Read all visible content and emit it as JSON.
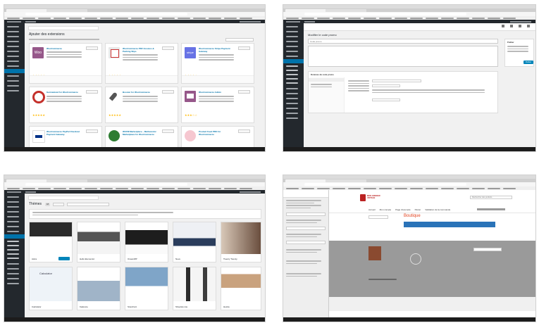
{
  "colors": {
    "wp_admin_dark": "#23282d",
    "wp_admin_blue": "#0073aa",
    "woo_purple": "#96588a",
    "stripe_purple": "#6772e5",
    "elementor_grey": "#7a7a7a",
    "star_gold": "#ffb900",
    "boutique_red": "#e2401c"
  },
  "shot1": {
    "page_title": "Ajouter des extensions",
    "plugins": [
      {
        "name": "WooCommerce",
        "icon": "woo-icon"
      },
      {
        "name": "WooCommerce PDF Invoices & Packing Slips",
        "icon": "invoice-icon"
      },
      {
        "name": "WooCommerce Stripe Payment Gateway",
        "icon": "stripe-icon"
      },
      {
        "name": "Germanized for WooCommerce",
        "icon": "germanized-icon"
      },
      {
        "name": "Booster for WooCommerce",
        "icon": "rocket-icon"
      },
      {
        "name": "WooCommerce Admin",
        "icon": "admin-icon"
      },
      {
        "name": "WooCommerce PayPal Checkout Payment Gateway",
        "icon": "paypal-icon"
      },
      {
        "name": "WCFM Marketplace – Multivendor Marketplace for WooCommerce",
        "icon": "wcfm-icon"
      },
      {
        "name": "Product Feed PRO for WooCommerce",
        "icon": "pig-icon"
      }
    ],
    "woo_logo_text": "Woo",
    "stripe_logo_text": "stripe"
  },
  "shot2": {
    "page_title": "Modifier le code promo",
    "code_field_value": "Code promo",
    "publish_heading": "Publier",
    "publish_button": "Publier",
    "coupon_data_heading": "Données du code promo"
  },
  "shot3": {
    "page_title": "Thèmes",
    "theme_count": "18",
    "themes": [
      {
        "name": "Astra"
      },
      {
        "name": "Hello Elementor"
      },
      {
        "name": "OceanWP"
      },
      {
        "name": "Neve"
      },
      {
        "name": "Twenty Twenty"
      },
      {
        "name": "Calculator"
      },
      {
        "name": "Kadence"
      },
      {
        "name": "Storefront"
      },
      {
        "name": "Shopisle Lite"
      },
      {
        "name": "Hestia"
      }
    ]
  },
  "shot4": {
    "logo_text": "MON GRENIER VINTAGE",
    "page_title": "Boutique",
    "nav": [
      "Accueil",
      "Mon compte",
      "Page d'exemple",
      "Panier",
      "Validation de la commande"
    ],
    "search_placeholder": "Rechercher des produits…"
  }
}
